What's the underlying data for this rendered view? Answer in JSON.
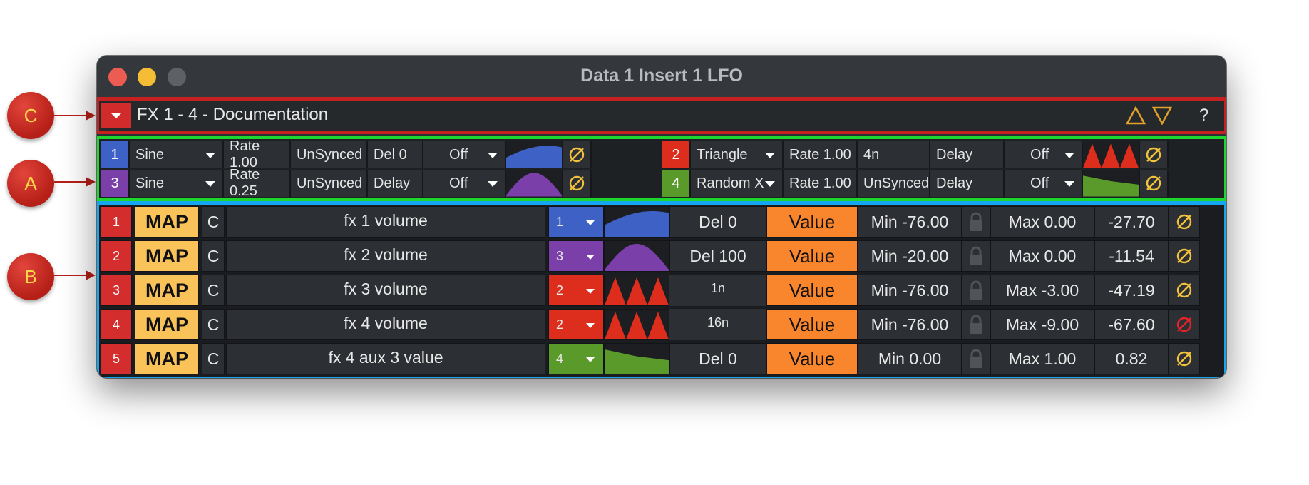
{
  "window": {
    "title": "Data 1 Insert 1 LFO"
  },
  "callouts": {
    "c": "C",
    "a": "A",
    "b": "B"
  },
  "preset": {
    "name": "FX 1 - 4 - Documentation",
    "help_label": "?"
  },
  "colors": {
    "lfo1": "#3e61c6",
    "lfo2": "#dd2e1d",
    "lfo3": "#7a3fa8",
    "lfo4": "#5a9a2a",
    "accent_map": "#f9c35a",
    "accent_value": "#f9852d",
    "section_a": "#1ed72e",
    "section_b": "#14a6f0",
    "section_c": "#c62020"
  },
  "lfos": [
    {
      "num": "1",
      "shape": "Sine",
      "rate": "Rate 1.00",
      "sync": "UnSynced",
      "delay": "Del 0",
      "retrig": "Off",
      "wave": "sine",
      "null_icon": "null-icon"
    },
    {
      "num": "2",
      "shape": "Triangle",
      "rate": "Rate 1.00",
      "sync": "4n",
      "delay": "Delay",
      "retrig": "Off",
      "wave": "triangle",
      "null_icon": "null-icon"
    },
    {
      "num": "3",
      "shape": "Sine",
      "rate": "Rate 0.25",
      "sync": "UnSynced",
      "delay": "Delay",
      "retrig": "Off",
      "wave": "sine",
      "null_icon": "null-icon"
    },
    {
      "num": "4",
      "shape": "Random X",
      "rate": "Rate 1.00",
      "sync": "UnSynced",
      "delay": "Delay",
      "retrig": "Off",
      "wave": "random",
      "null_icon": "null-icon"
    }
  ],
  "mappings": [
    {
      "num": "1",
      "map": "MAP",
      "c": "C",
      "param": "fx 1 volume",
      "lfo": "1",
      "delay": "Del 0",
      "mode": "Value",
      "min": "Min -76.00",
      "max": "Max 0.00",
      "current": "-27.70",
      "null_state": "normal"
    },
    {
      "num": "2",
      "map": "MAP",
      "c": "C",
      "param": "fx 2 volume",
      "lfo": "3",
      "delay": "Del 100",
      "mode": "Value",
      "min": "Min -20.00",
      "max": "Max 0.00",
      "current": "-11.54",
      "null_state": "normal"
    },
    {
      "num": "3",
      "map": "MAP",
      "c": "C",
      "param": "fx 3 volume",
      "lfo": "2",
      "delay": "1n",
      "mode": "Value",
      "min": "Min -76.00",
      "max": "Max -3.00",
      "current": "-47.19",
      "null_state": "normal"
    },
    {
      "num": "4",
      "map": "MAP",
      "c": "C",
      "param": "fx 4 volume",
      "lfo": "2",
      "delay": "16n",
      "mode": "Value",
      "min": "Min -76.00",
      "max": "Max -9.00",
      "current": "-67.60",
      "null_state": "active-red"
    },
    {
      "num": "5",
      "map": "MAP",
      "c": "C",
      "param": "fx 4 aux 3 value",
      "lfo": "4",
      "delay": "Del 0",
      "mode": "Value",
      "min": "Min 0.00",
      "max": "Max 1.00",
      "current": "0.82",
      "null_state": "normal"
    }
  ]
}
